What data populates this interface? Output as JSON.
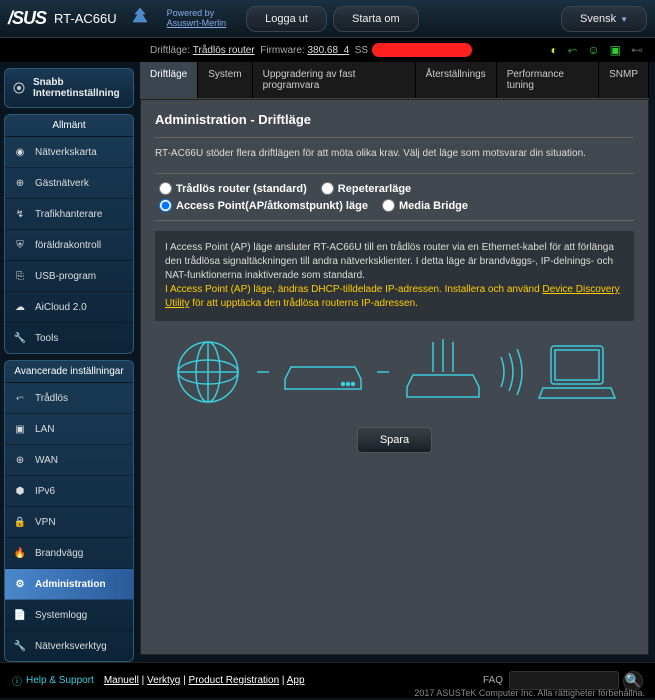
{
  "header": {
    "brand": "/SUS",
    "model": "RT-AC66U",
    "powered_label": "Powered by",
    "powered_name": "Asuswrt-Merlin",
    "logout": "Logga ut",
    "reboot": "Starta om",
    "language": "Svensk"
  },
  "infobar": {
    "mode_label": "Driftläge:",
    "mode_value": "Trådlös router",
    "fw_label": "Firmware:",
    "fw_value": "380.68_4",
    "ssid_label": "SS"
  },
  "sidebar": {
    "quick": "Snabb Internetinställning",
    "section_general": "Allmänt",
    "general": [
      "Nätverkskarta",
      "Gästnätverk",
      "Trafikhanterare",
      "föräldrakontroll",
      "USB-program",
      "AiCloud 2.0",
      "Tools"
    ],
    "section_advanced": "Avancerade inställningar",
    "advanced": [
      "Trådlös",
      "LAN",
      "WAN",
      "IPv6",
      "VPN",
      "Brandvägg",
      "Administration",
      "Systemlogg",
      "Nätverksverktyg"
    ],
    "active_advanced_index": 6
  },
  "tabs": {
    "items": [
      "Driftläge",
      "System",
      "Uppgradering av fast programvara",
      "Återställnings",
      "Performance tuning",
      "SNMP"
    ],
    "active_index": 0
  },
  "panel": {
    "title": "Administration - Driftläge",
    "desc": "RT-AC66U stöder flera driftlägen för att möta olika krav. Välj det läge som motsvarar din situation.",
    "modes": {
      "wireless_router": "Trådlös router (standard)",
      "repeater": "Repeterarläge",
      "ap": "Access Point(AP/åtkomstpunkt) läge",
      "media_bridge": "Media Bridge",
      "selected": "ap"
    },
    "info_line1": "I Access Point (AP) läge ansluter RT-AC66U till en trådlös router via en Ethernet-kabel för att förlänga den trådlösa signaltäckningen till andra nätverksklienter. I detta läge är brandväggs-, IP-delnings- och NAT-funktionerna inaktiverade som standard.",
    "info_warn_prefix": "I Access Point (AP) läge, ändras DHCP-tilldelade IP-adressen. Installera och använd ",
    "info_link": "Device Discovery Utility",
    "info_warn_suffix": " för att upptäcka den trådlösa routerns IP-adressen.",
    "save": "Spara"
  },
  "footer": {
    "help": "Help & Support",
    "links": [
      "Manuell",
      "Verktyg",
      "Product Registration",
      "App"
    ],
    "faq": "FAQ",
    "search_placeholder": "",
    "copyright": "2017 ASUSTeK Computer Inc. Alla rättigheter förbehållna."
  }
}
